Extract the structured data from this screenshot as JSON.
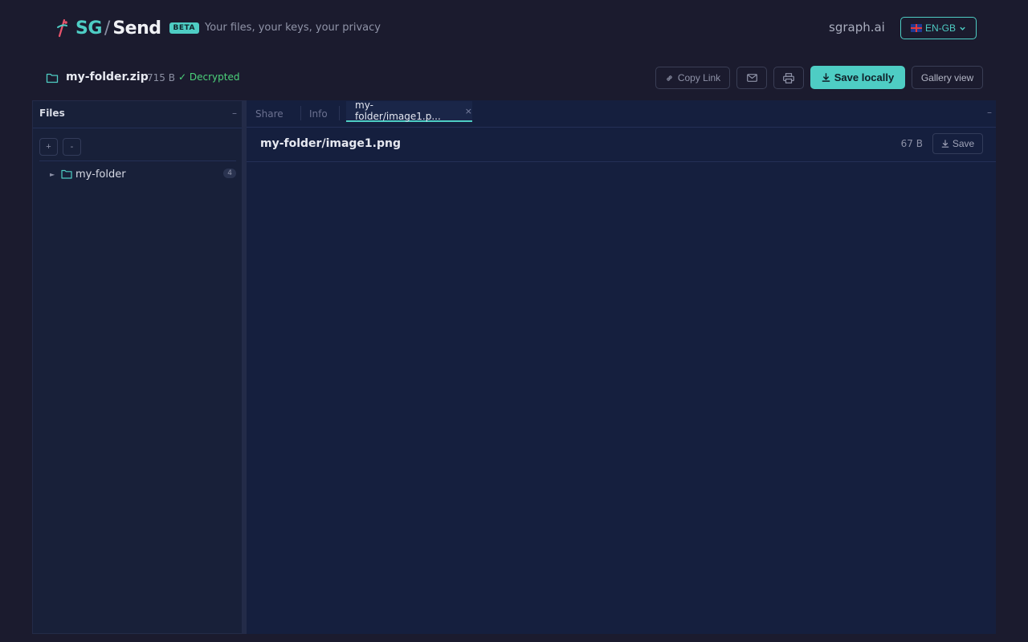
{
  "header": {
    "logo_sg": "SG",
    "logo_slash": "/",
    "logo_send": "Send",
    "beta_badge": "BETA",
    "tagline": "Your files, your keys, your privacy",
    "site_link": "sgraph.ai",
    "language": "EN-GB"
  },
  "file": {
    "name": "my-folder.zip",
    "size": "715 B",
    "status": "✓ Decrypted"
  },
  "actions": {
    "copy_link": "Copy Link",
    "save_locally": "Save locally",
    "gallery_view": "Gallery view"
  },
  "files_panel": {
    "title": "Files",
    "minimize": "–",
    "add": "+",
    "remove": "-",
    "tree": [
      {
        "label": "my-folder",
        "count": "4"
      }
    ]
  },
  "tabs": {
    "share": "Share",
    "info": "Info",
    "active": "my-folder/image1.p...",
    "close": "×",
    "minimize": "–"
  },
  "viewer": {
    "title": "my-folder/image1.png",
    "size": "67 B",
    "save": "Save"
  },
  "colors": {
    "accent": "#4ecdc4",
    "success": "#4cd27a",
    "background": "#1b1b2e",
    "panel": "#151f3e"
  }
}
